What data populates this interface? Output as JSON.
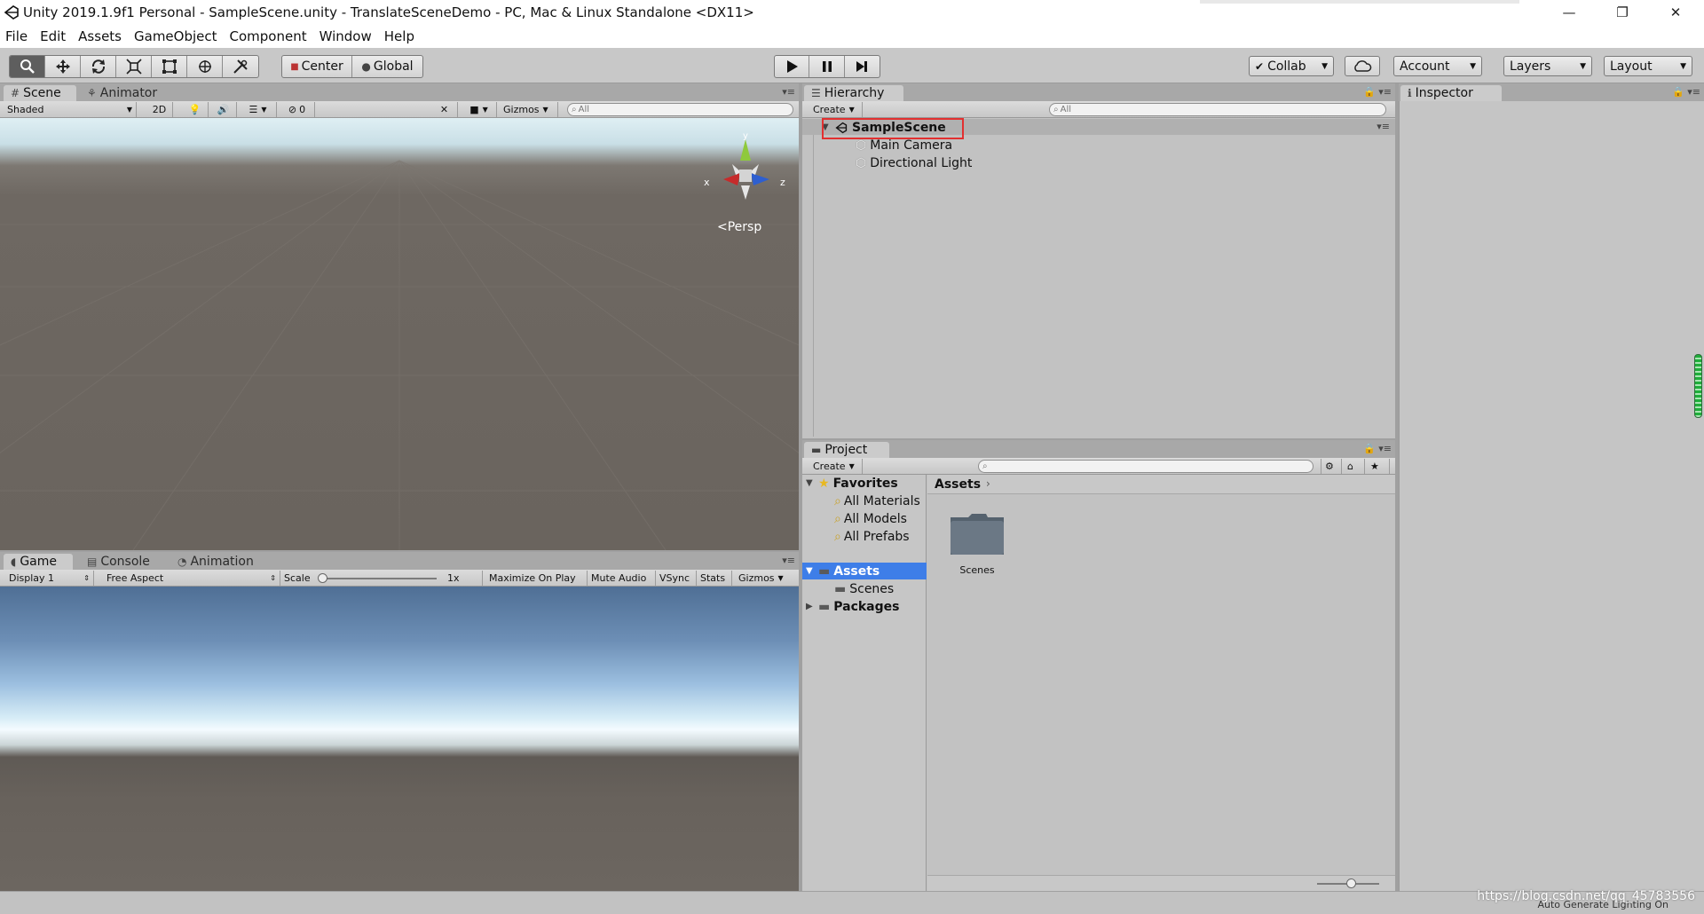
{
  "window": {
    "title": "Unity 2019.1.9f1 Personal - SampleScene.unity - TranslateSceneDemo - PC, Mac & Linux Standalone <DX11>",
    "controls": [
      "—",
      "❐",
      "✕"
    ]
  },
  "menu": [
    "File",
    "Edit",
    "Assets",
    "GameObject",
    "Component",
    "Window",
    "Help"
  ],
  "toolbar": {
    "pivot_center": "Center",
    "pivot_global": "Global",
    "collab": "Collab",
    "account": "Account",
    "layers": "Layers",
    "layout": "Layout"
  },
  "scene_panel": {
    "tabs": [
      "Scene",
      "Animator"
    ],
    "shading": "Shaded",
    "mode_2d": "2D",
    "hidden_count": "0",
    "gizmos": "Gizmos",
    "search_placeholder": "All",
    "gizmo_axes": {
      "x": "x",
      "y": "y",
      "z": "z"
    },
    "persp": "Persp"
  },
  "game_panel": {
    "tabs": [
      "Game",
      "Console",
      "Animation"
    ],
    "display": "Display 1",
    "aspect": "Free Aspect",
    "scale_label": "Scale",
    "scale_value": "1x",
    "maximize": "Maximize On Play",
    "mute": "Mute Audio",
    "vsync": "VSync",
    "stats": "Stats",
    "gizmos": "Gizmos"
  },
  "hierarchy": {
    "tab": "Hierarchy",
    "create": "Create",
    "search_placeholder": "All",
    "scene": "SampleScene",
    "objects": [
      "Main Camera",
      "Directional Light"
    ]
  },
  "project": {
    "tab": "Project",
    "create": "Create",
    "favorites": "Favorites",
    "favorite_items": [
      "All Materials",
      "All Models",
      "All Prefabs"
    ],
    "assets": "Assets",
    "asset_children": [
      "Scenes"
    ],
    "packages": "Packages",
    "breadcrumb": "Assets",
    "grid_items": [
      "Scenes"
    ]
  },
  "inspector": {
    "tab": "Inspector"
  },
  "status": {
    "message": "Auto Generate Lighting On",
    "watermark": "https://blog.csdn.net/qq_45783556"
  }
}
